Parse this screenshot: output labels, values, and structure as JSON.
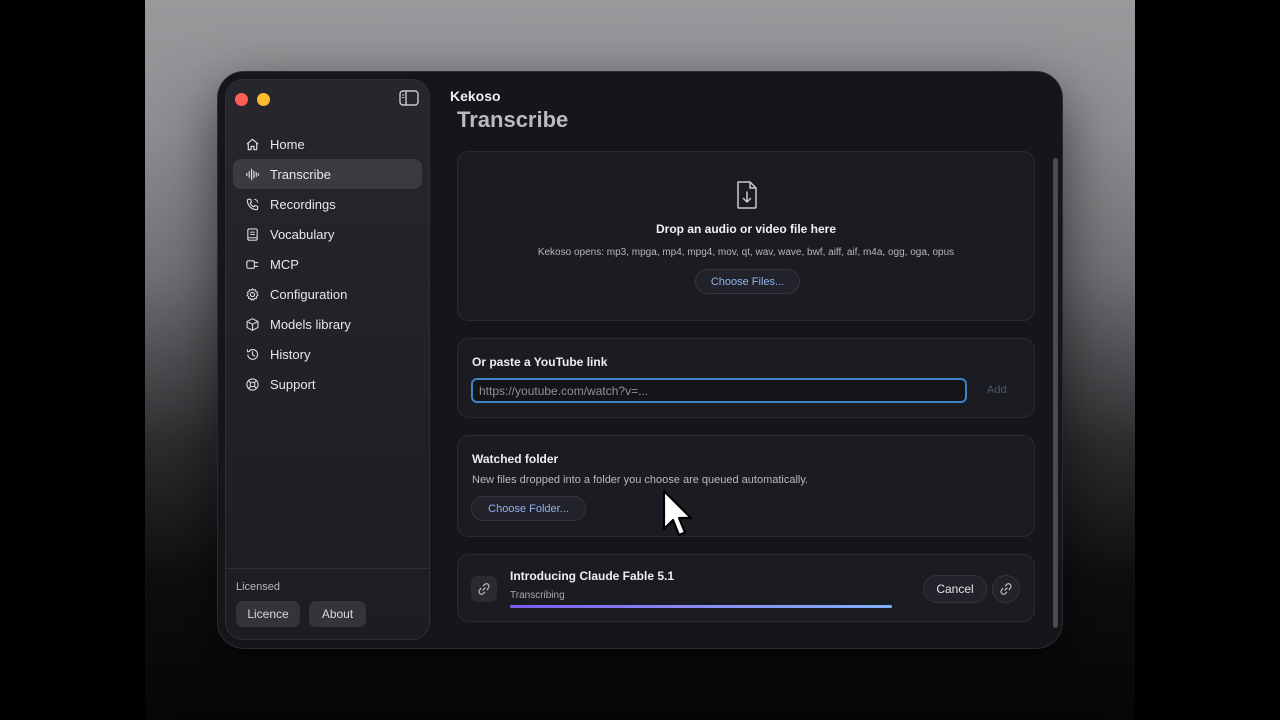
{
  "app": {
    "name": "Kekoso"
  },
  "sidebar": {
    "items": [
      {
        "label": "Home",
        "icon": "home-icon"
      },
      {
        "label": "Transcribe",
        "icon": "waveform-icon",
        "active": true
      },
      {
        "label": "Recordings",
        "icon": "phone-icon"
      },
      {
        "label": "Vocabulary",
        "icon": "book-icon"
      },
      {
        "label": "MCP",
        "icon": "plug-icon"
      },
      {
        "label": "Configuration",
        "icon": "gear-icon"
      },
      {
        "label": "Models library",
        "icon": "cube-icon"
      },
      {
        "label": "History",
        "icon": "history-icon"
      },
      {
        "label": "Support",
        "icon": "lifebuoy-icon"
      }
    ],
    "footer": {
      "status": "Licensed",
      "licence_label": "Licence",
      "about_label": "About"
    }
  },
  "main": {
    "title": "Transcribe",
    "drop": {
      "heading": "Drop an audio or video file here",
      "formats": "Kekoso opens: mp3, mpga, mp4, mpg4, mov, qt, wav, wave, bwf, aiff, aif, m4a, ogg, oga, opus",
      "button": "Choose Files..."
    },
    "youtube": {
      "label": "Or paste a YouTube link",
      "placeholder": "https://youtube.com/watch?v=...",
      "value": "",
      "add_label": "Add"
    },
    "watched": {
      "label": "Watched folder",
      "description": "New files dropped into a folder you choose are queued automatically.",
      "button": "Choose Folder..."
    },
    "job": {
      "title": "Introducing Claude Fable 5.1",
      "status": "Transcribing",
      "progress": 1.0,
      "cancel_label": "Cancel"
    }
  },
  "colors": {
    "accent_link": "#8fb2f0",
    "input_focus": "#3e83c8",
    "progress_start": "#7b5cf0",
    "progress_end": "#7fb0f7",
    "traffic_red": "#fe5f57",
    "traffic_yellow": "#febc2e"
  }
}
